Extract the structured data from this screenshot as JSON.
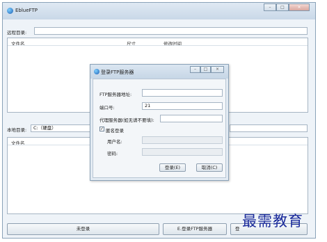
{
  "app": {
    "title": "EblueFTP"
  },
  "window_controls": {
    "minimize": "–",
    "maximize": "□",
    "close": "×"
  },
  "remote": {
    "label": "远程目录:",
    "value": ""
  },
  "remote_list": {
    "columns": [
      "文件名",
      "尺寸",
      "修改时间"
    ]
  },
  "local": {
    "label": "本地目录:",
    "value": "C:（硬盘）"
  },
  "local_list": {
    "columns": [
      "文件名"
    ]
  },
  "status": {
    "text": "未登录"
  },
  "bottom": {
    "login_button": "E.登录FTP服务器",
    "partial_button": "登"
  },
  "dialog": {
    "title": "登录FTP服务器",
    "server_label": "FTP服务器地址:",
    "server_value": "",
    "port_label": "端口号:",
    "port_value": "21",
    "proxy_label": "代理服务器(如无请不要填):",
    "proxy_value": "",
    "anonymous_label": "匿名登录",
    "anonymous_checked": true,
    "username_label": "用户名:",
    "password_label": "密码:",
    "login_button": "登录(E)",
    "cancel_button": "取消(C)"
  },
  "watermark": "最需教育"
}
